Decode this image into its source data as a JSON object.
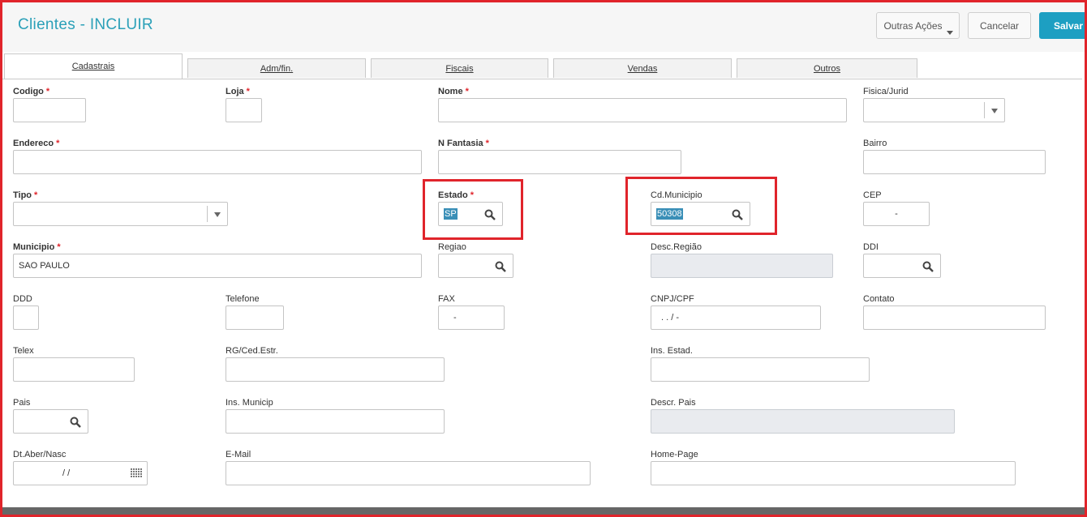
{
  "header": {
    "title": "Clientes - INCLUIR",
    "more_actions": "Outras Ações",
    "cancel": "Cancelar",
    "save": "Salvar"
  },
  "tabs": [
    "Cadastrais",
    "Adm/fin.",
    "Fiscais",
    "Vendas",
    "Outros"
  ],
  "fields": {
    "codigo": {
      "label": "Codigo",
      "value": ""
    },
    "loja": {
      "label": "Loja",
      "value": ""
    },
    "nome": {
      "label": "Nome",
      "value": ""
    },
    "fisica_jurid": {
      "label": "Fisica/Jurid",
      "value": ""
    },
    "endereco": {
      "label": "Endereco",
      "value": ""
    },
    "n_fantasia": {
      "label": "N Fantasia",
      "value": ""
    },
    "bairro": {
      "label": "Bairro",
      "value": ""
    },
    "tipo": {
      "label": "Tipo",
      "value": ""
    },
    "estado": {
      "label": "Estado",
      "value": "SP"
    },
    "cd_municipio": {
      "label": "Cd.Municipio",
      "value": "50308"
    },
    "cep": {
      "label": "CEP",
      "value": "-"
    },
    "municipio": {
      "label": "Municipio",
      "value": "SAO PAULO"
    },
    "regiao": {
      "label": "Regiao",
      "value": ""
    },
    "desc_regiao": {
      "label": "Desc.Região",
      "value": ""
    },
    "ddi": {
      "label": "DDI",
      "value": ""
    },
    "ddd": {
      "label": "DDD",
      "value": ""
    },
    "telefone": {
      "label": "Telefone",
      "value": ""
    },
    "fax": {
      "label": "FAX",
      "value": "-"
    },
    "cnpj_cpf": {
      "label": "CNPJ/CPF",
      "value": ". . / -"
    },
    "contato": {
      "label": "Contato",
      "value": ""
    },
    "telex": {
      "label": "Telex",
      "value": ""
    },
    "rg_ced": {
      "label": "RG/Ced.Estr.",
      "value": ""
    },
    "ins_estad": {
      "label": "Ins. Estad.",
      "value": ""
    },
    "pais": {
      "label": "Pais",
      "value": ""
    },
    "ins_municip": {
      "label": "Ins. Municip",
      "value": ""
    },
    "descr_pais": {
      "label": "Descr. Pais",
      "value": ""
    },
    "dt_aber": {
      "label": "Dt.Aber/Nasc",
      "value": "/ /"
    },
    "email": {
      "label": "E-Mail",
      "value": ""
    },
    "home_page": {
      "label": "Home-Page",
      "value": ""
    }
  },
  "icons": {
    "lookup": "search-icon",
    "calendar": "calendar-icon",
    "dropdown": "chevron-down-icon"
  },
  "colors": {
    "accent": "#2ba0b8",
    "save_button": "#1d9fc2",
    "required": "#e0242b",
    "highlight_box": "#e0242b"
  }
}
